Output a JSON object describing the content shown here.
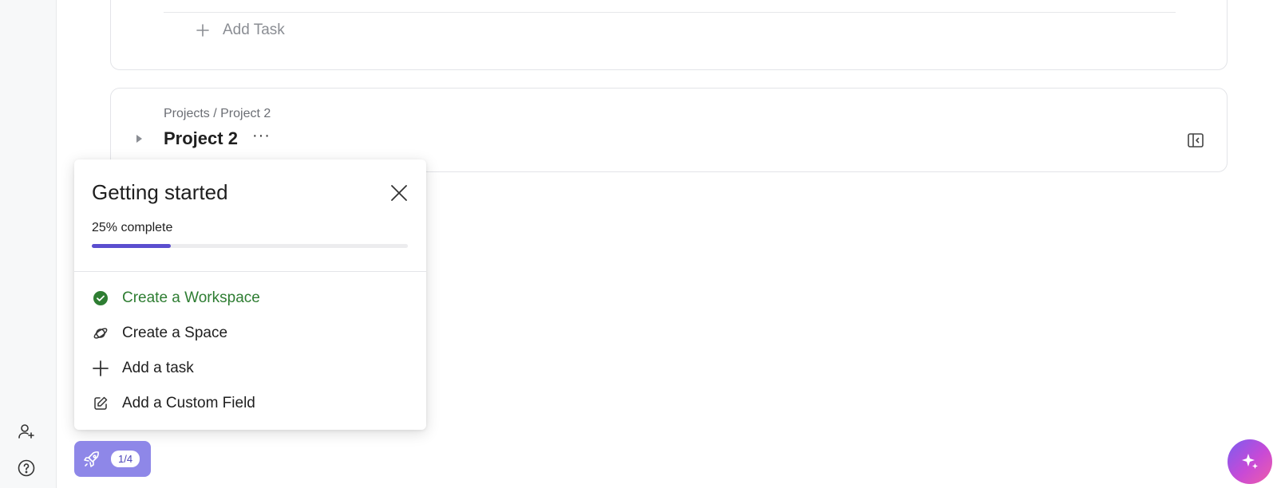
{
  "top_card": {
    "add_task_label": "Add Task"
  },
  "project_card": {
    "breadcrumb": "Projects / Project 2",
    "title": "Project 2",
    "more_label": "···"
  },
  "getting_started": {
    "title": "Getting started",
    "progress_label": "25% complete",
    "progress_percent": 25,
    "progress_color": "#5b4ecf",
    "items": [
      {
        "label": "Create a Workspace",
        "icon": "check-circle-icon",
        "done": true
      },
      {
        "label": "Create a Space",
        "icon": "planet-icon",
        "done": false
      },
      {
        "label": "Add a task",
        "icon": "plus-icon",
        "done": false
      },
      {
        "label": "Add a Custom Field",
        "icon": "edit-square-icon",
        "done": false
      }
    ]
  },
  "launcher": {
    "badge": "1/4",
    "icon": "rocket-icon"
  },
  "left_rail": {
    "icons": [
      "invite-user-icon",
      "help-icon"
    ]
  },
  "ai_button": {
    "icon": "sparkle-icon"
  }
}
